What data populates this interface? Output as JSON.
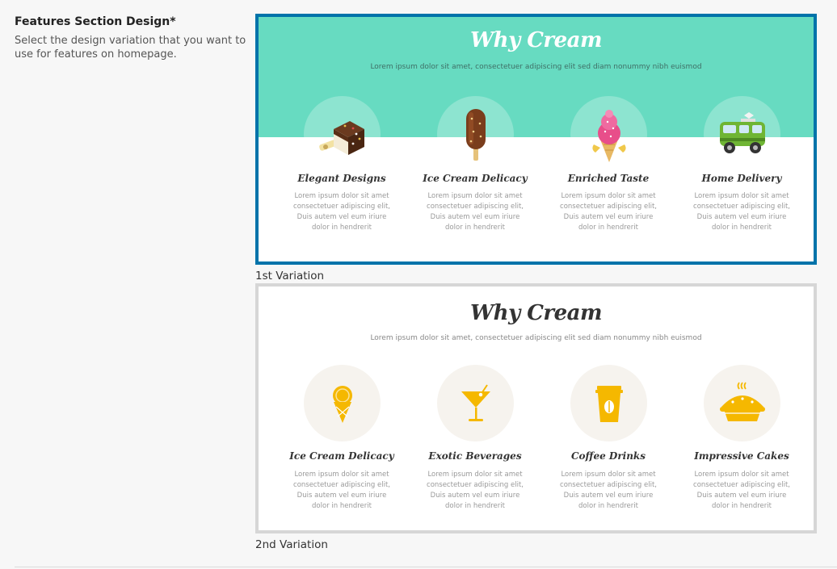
{
  "field": {
    "title": "Features Section Design*",
    "description": "Select the design variation that you want to use for features on homepage."
  },
  "variations": [
    {
      "caption": "1st Variation",
      "selected": true,
      "accent": "#0073aa",
      "band_color": "#67dbc1",
      "heading": "Why Cream",
      "subheading": "Lorem ipsum dolor sit amet, consectetuer adipiscing elit sed diam nonummy nibh euismod",
      "features": [
        {
          "icon": "chocolate-cube-icon",
          "title": "Elegant Designs",
          "text": "Lorem ipsum dolor sit amet consectetuer adipiscing elit, Duis autem vel eum iriure dolor in hendrerit"
        },
        {
          "icon": "popsicle-icon",
          "title": "Ice Cream Delicacy",
          "text": "Lorem ipsum dolor sit amet consectetuer adipiscing elit, Duis autem vel eum iriure dolor in hendrerit"
        },
        {
          "icon": "ice-cream-cone-icon",
          "title": "Enriched Taste",
          "text": "Lorem ipsum dolor sit amet consectetuer adipiscing elit, Duis autem vel eum iriure dolor in hendrerit"
        },
        {
          "icon": "delivery-van-icon",
          "title": "Home Delivery",
          "text": "Lorem ipsum dolor sit amet consectetuer adipiscing elit, Duis autem vel eum iriure dolor in hendrerit"
        }
      ]
    },
    {
      "caption": "2nd Variation",
      "selected": false,
      "accent": "#d6d6d6",
      "icon_color": "#f5b800",
      "heading": "Why Cream",
      "subheading": "Lorem ipsum dolor sit amet, consectetuer adipiscing elit sed diam nonummy nibh euismod",
      "features": [
        {
          "icon": "ice-cream-icon",
          "title": "Ice Cream Delicacy",
          "text": "Lorem ipsum dolor sit amet consectetuer adipiscing elit, Duis autem vel eum iriure dolor in hendrerit"
        },
        {
          "icon": "cocktail-icon",
          "title": "Exotic Beverages",
          "text": "Lorem ipsum dolor sit amet consectetuer adipiscing elit, Duis autem vel eum iriure dolor in hendrerit"
        },
        {
          "icon": "coffee-cup-icon",
          "title": "Coffee Drinks",
          "text": "Lorem ipsum dolor sit amet consectetuer adipiscing elit, Duis autem vel eum iriure dolor in hendrerit"
        },
        {
          "icon": "pie-icon",
          "title": "Impressive Cakes",
          "text": "Lorem ipsum dolor sit amet consectetuer adipiscing elit, Duis autem vel eum iriure dolor in hendrerit"
        }
      ]
    }
  ]
}
